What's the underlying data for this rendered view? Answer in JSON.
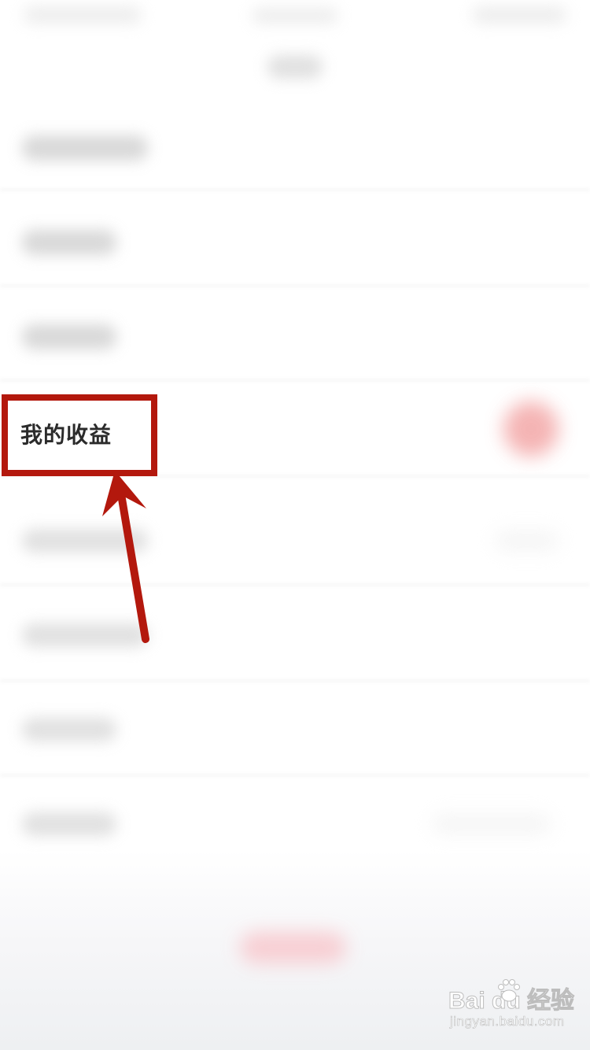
{
  "highlighted_item": {
    "label": "我的收益"
  },
  "watermark": {
    "brand": "Bai du 经验",
    "url": "jingyan.baidu.com"
  },
  "colors": {
    "highlight_border": "#b3180d",
    "arrow": "#b3180d",
    "label_text": "#2b2b2b",
    "blurred_accent": "#f3a7a7"
  },
  "icons": {
    "annotation_arrow": "arrow-up-icon",
    "watermark_logo": "paw-icon"
  }
}
